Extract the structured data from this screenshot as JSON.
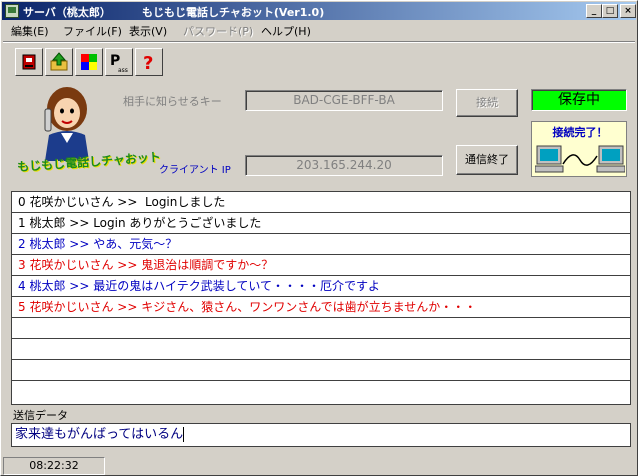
{
  "window": {
    "title": "サーバ（桃太郎）",
    "subtitle": "もじもじ電話しチャおット(Ver1.0)",
    "controls": {
      "minimize": "_",
      "maximize": "□",
      "close": "×"
    }
  },
  "menu": {
    "items": [
      {
        "label": "編集(E)",
        "disabled": false
      },
      {
        "label": "ファイル(F)",
        "disabled": false
      },
      {
        "label": "表示(V)",
        "disabled": false
      },
      {
        "label": "パスワード(P)",
        "disabled": true
      },
      {
        "label": "ヘルプ(H)",
        "disabled": false
      }
    ]
  },
  "toolbar": {
    "buttons": [
      {
        "icon": "exit-icon"
      },
      {
        "icon": "upload-icon"
      },
      {
        "icon": "color-palette-icon"
      },
      {
        "icon": "password-icon",
        "text": "P",
        "subtext": "ass"
      },
      {
        "icon": "help-icon",
        "text": "?"
      }
    ]
  },
  "mascot": {
    "caption": "もじもじ電話しチャおット"
  },
  "connection": {
    "key_label": "相手に知らせるキー",
    "key_value": "BAD-CGE-BFF-BA",
    "ip_label": "クライアント IP",
    "ip_value": "203.165.244.20",
    "connect_button": "接続",
    "end_button": "通信終了",
    "status": "保存中",
    "status_color": "#00ff00",
    "complete_text": "接続完了！"
  },
  "chat": {
    "rows": [
      {
        "text": "0 花咲かじいさん >>  Loginしました",
        "color": "#000000"
      },
      {
        "text": "1 桃太郎 >> Login ありがとうございました",
        "color": "#000000"
      },
      {
        "text": "2 桃太郎 >> やあ、元気～？",
        "color": "#0000c0"
      },
      {
        "text": "3 花咲かじいさん >> 鬼退治は順調ですか～？",
        "color": "#e00000"
      },
      {
        "text": "4 桃太郎 >> 最近の鬼はハイテク武装していて・・・・厄介ですよ",
        "color": "#0000c0"
      },
      {
        "text": "5 花咲かじいさん >> キジさん、猿さん、ワンワンさんでは歯が立ちませんか・・・",
        "color": "#e00000"
      },
      {
        "text": "",
        "color": "#000000"
      },
      {
        "text": "",
        "color": "#000000"
      },
      {
        "text": "",
        "color": "#000000"
      },
      {
        "text": "",
        "color": "#000000"
      }
    ]
  },
  "send": {
    "label": "送信データ",
    "value": "家来達もがんばってはいるん"
  },
  "statusbar": {
    "time": "08:22:32"
  }
}
